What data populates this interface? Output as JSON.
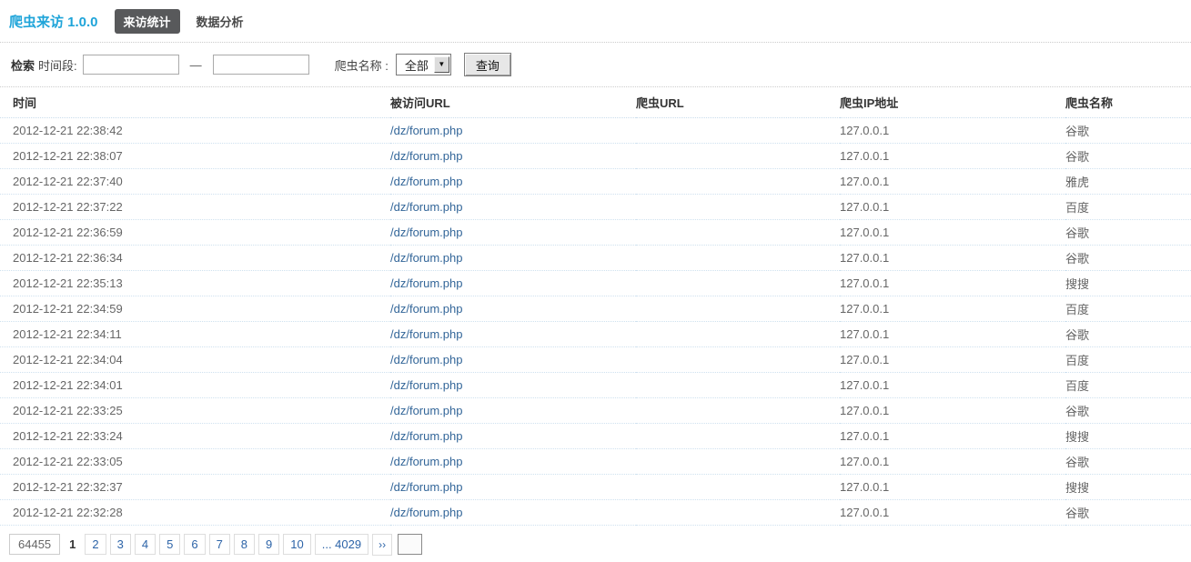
{
  "header": {
    "title": "爬虫来访 1.0.0",
    "tabs": [
      {
        "label": "来访统计",
        "active": true
      },
      {
        "label": "数据分析",
        "active": false
      }
    ]
  },
  "search": {
    "label": "检索",
    "time_range_label": "时间段:",
    "start_value": "",
    "end_value": "",
    "separator": "—",
    "crawler_name_label": "爬虫名称 :",
    "crawler_select_value": "全部",
    "query_button": "查询"
  },
  "table": {
    "columns": [
      "时间",
      "被访问URL",
      "爬虫URL",
      "爬虫IP地址",
      "爬虫名称"
    ],
    "rows": [
      {
        "time": "2012-12-21 22:38:42",
        "visited_url": "/dz/forum.php",
        "crawler_url": "",
        "ip": "127.0.0.1",
        "name": "谷歌"
      },
      {
        "time": "2012-12-21 22:38:07",
        "visited_url": "/dz/forum.php",
        "crawler_url": "",
        "ip": "127.0.0.1",
        "name": "谷歌"
      },
      {
        "time": "2012-12-21 22:37:40",
        "visited_url": "/dz/forum.php",
        "crawler_url": "",
        "ip": "127.0.0.1",
        "name": "雅虎"
      },
      {
        "time": "2012-12-21 22:37:22",
        "visited_url": "/dz/forum.php",
        "crawler_url": "",
        "ip": "127.0.0.1",
        "name": "百度"
      },
      {
        "time": "2012-12-21 22:36:59",
        "visited_url": "/dz/forum.php",
        "crawler_url": "",
        "ip": "127.0.0.1",
        "name": "谷歌"
      },
      {
        "time": "2012-12-21 22:36:34",
        "visited_url": "/dz/forum.php",
        "crawler_url": "",
        "ip": "127.0.0.1",
        "name": "谷歌"
      },
      {
        "time": "2012-12-21 22:35:13",
        "visited_url": "/dz/forum.php",
        "crawler_url": "",
        "ip": "127.0.0.1",
        "name": "搜搜"
      },
      {
        "time": "2012-12-21 22:34:59",
        "visited_url": "/dz/forum.php",
        "crawler_url": "",
        "ip": "127.0.0.1",
        "name": "百度"
      },
      {
        "time": "2012-12-21 22:34:11",
        "visited_url": "/dz/forum.php",
        "crawler_url": "",
        "ip": "127.0.0.1",
        "name": "谷歌"
      },
      {
        "time": "2012-12-21 22:34:04",
        "visited_url": "/dz/forum.php",
        "crawler_url": "",
        "ip": "127.0.0.1",
        "name": "百度"
      },
      {
        "time": "2012-12-21 22:34:01",
        "visited_url": "/dz/forum.php",
        "crawler_url": "",
        "ip": "127.0.0.1",
        "name": "百度"
      },
      {
        "time": "2012-12-21 22:33:25",
        "visited_url": "/dz/forum.php",
        "crawler_url": "",
        "ip": "127.0.0.1",
        "name": "谷歌"
      },
      {
        "time": "2012-12-21 22:33:24",
        "visited_url": "/dz/forum.php",
        "crawler_url": "",
        "ip": "127.0.0.1",
        "name": "搜搜"
      },
      {
        "time": "2012-12-21 22:33:05",
        "visited_url": "/dz/forum.php",
        "crawler_url": "",
        "ip": "127.0.0.1",
        "name": "谷歌"
      },
      {
        "time": "2012-12-21 22:32:37",
        "visited_url": "/dz/forum.php",
        "crawler_url": "",
        "ip": "127.0.0.1",
        "name": "搜搜"
      },
      {
        "time": "2012-12-21 22:32:28",
        "visited_url": "/dz/forum.php",
        "crawler_url": "",
        "ip": "127.0.0.1",
        "name": "谷歌"
      }
    ]
  },
  "pagination": {
    "total": "64455",
    "current_page": "1",
    "pages": [
      "2",
      "3",
      "4",
      "5",
      "6",
      "7",
      "8",
      "9",
      "10"
    ],
    "last_page": "... 4029",
    "next": "››",
    "jump_value": ""
  },
  "icons": {
    "select_arrow": "chevron-down-icon"
  },
  "colors": {
    "title_blue": "#1ea4d9",
    "tab_active_bg": "#58595b",
    "link_blue": "#336699",
    "row_divider": "#cfe1ef",
    "section_divider": "#cccccc",
    "text_gray": "#666666"
  }
}
